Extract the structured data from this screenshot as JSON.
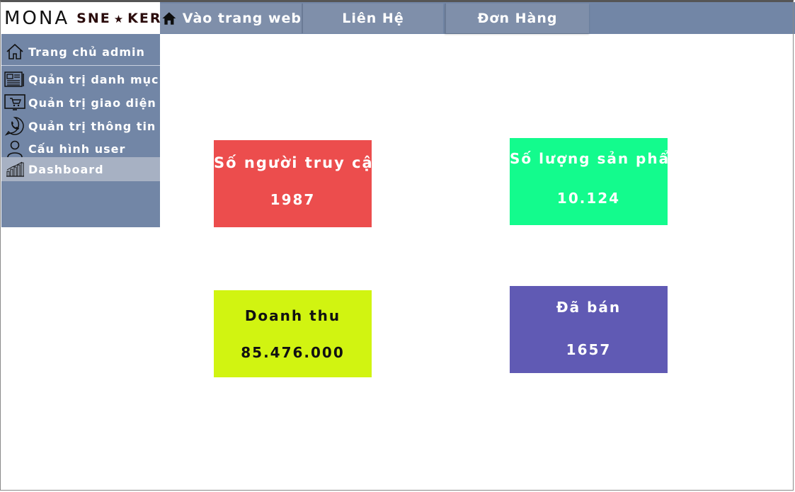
{
  "logo": {
    "brand_left": "MONA",
    "brand_right_a": "SNE",
    "brand_star": "★",
    "brand_right_b": "KER"
  },
  "topnav": {
    "home_label": "Vào trang web",
    "contact_label": "Liên Hệ",
    "orders_label": "Đơn Hàng"
  },
  "sidebar": {
    "items": [
      {
        "label": "Trang chủ admin",
        "icon": "house-outline-icon"
      },
      {
        "label": "Quản trị danh mục",
        "icon": "newspaper-icon"
      },
      {
        "label": "Quản trị giao diện",
        "icon": "cart-monitor-icon"
      },
      {
        "label": "Quản trị thông tin",
        "icon": "phone-chat-icon"
      },
      {
        "label": "Cấu hình user",
        "icon": "user-icon"
      },
      {
        "label": "Dashboard",
        "icon": "bar-chart-icon",
        "active": true
      }
    ]
  },
  "stats": [
    {
      "title": "Số người truy cập",
      "value": "1987",
      "color": "#ec4d4d"
    },
    {
      "title": "Số lượng sản phẩm",
      "value": "10.124",
      "color": "#13fb8d"
    },
    {
      "title": "Doanh thu",
      "value": "85.476.000",
      "color": "#d1f411"
    },
    {
      "title": "Đã bán",
      "value": "1657",
      "color": "#605ab4"
    }
  ],
  "colors": {
    "nav": "#7286a6",
    "active_item": "#a7b1c3"
  }
}
